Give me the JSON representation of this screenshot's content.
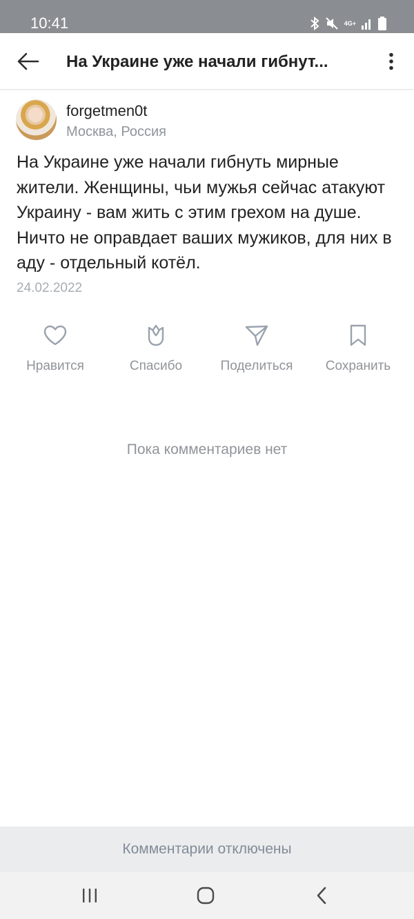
{
  "status_bar": {
    "time": "10:41",
    "network_label": "4G+",
    "icons": [
      "bluetooth-icon",
      "mute-icon",
      "network-4g-icon",
      "signal-icon",
      "battery-icon"
    ]
  },
  "app_bar": {
    "back_icon": "arrow-left-icon",
    "title": "На Украине уже начали гибнут...",
    "more_icon": "more-vertical-icon"
  },
  "post": {
    "author": "forgetmen0t",
    "location": "Москва, Россия",
    "text": "На Украине уже начали гибнуть мирные жители. Женщины, чьи мужья сейчас атакуют Украину - вам жить с этим грехом на душе. Ничто не оправдает ваших мужиков, для них в аду - отдельный котёл.",
    "date": "24.02.2022"
  },
  "actions": [
    {
      "label": "Нравится",
      "icon": "heart-icon"
    },
    {
      "label": "Спасибо",
      "icon": "tulip-icon"
    },
    {
      "label": "Поделиться",
      "icon": "send-icon"
    },
    {
      "label": "Сохранить",
      "icon": "bookmark-icon"
    }
  ],
  "comments": {
    "empty_text": "Пока комментариев нет",
    "disabled_text": "Комментарии отключены"
  },
  "nav_bar": {
    "buttons": [
      "recent-apps-icon",
      "home-icon",
      "back-icon"
    ]
  },
  "colors": {
    "status_bar": "#8a8d91",
    "text_primary": "#222222",
    "text_secondary": "#909499",
    "icon_accent": "#99a2ad",
    "footer_bg": "#ebeced"
  }
}
